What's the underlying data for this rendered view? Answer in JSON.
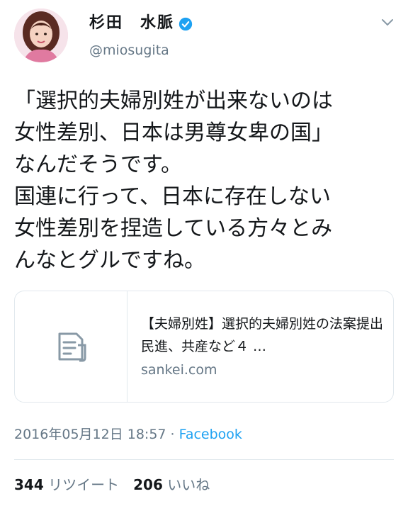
{
  "author": {
    "name": "杉田　水脈",
    "handle": "@miosugita",
    "verified_icon": "verified-badge-icon"
  },
  "tweet": {
    "text": "「選択的夫婦別姓が出来ないのは\n女性差別、日本は男尊女卑の国」\nなんだそうです。\n国連に行って、日本に存在しない\n女性差別を捏造している方々とみ\nんなとグルですね。"
  },
  "card": {
    "title": "【夫婦別姓】選択的夫婦別姓の法案提出　民進、共産など４ …",
    "domain": "sankei.com",
    "icon": "document-icon"
  },
  "meta": {
    "timestamp": "2016年05月12日 18:57",
    "separator": " · ",
    "source": "Facebook"
  },
  "stats": {
    "retweets_count": "344",
    "retweets_label": "リツイート",
    "likes_count": "206",
    "likes_label": "いいね"
  },
  "colors": {
    "accent": "#1da1f2",
    "secondary_text": "#657786",
    "border": "#e1e8ed"
  }
}
